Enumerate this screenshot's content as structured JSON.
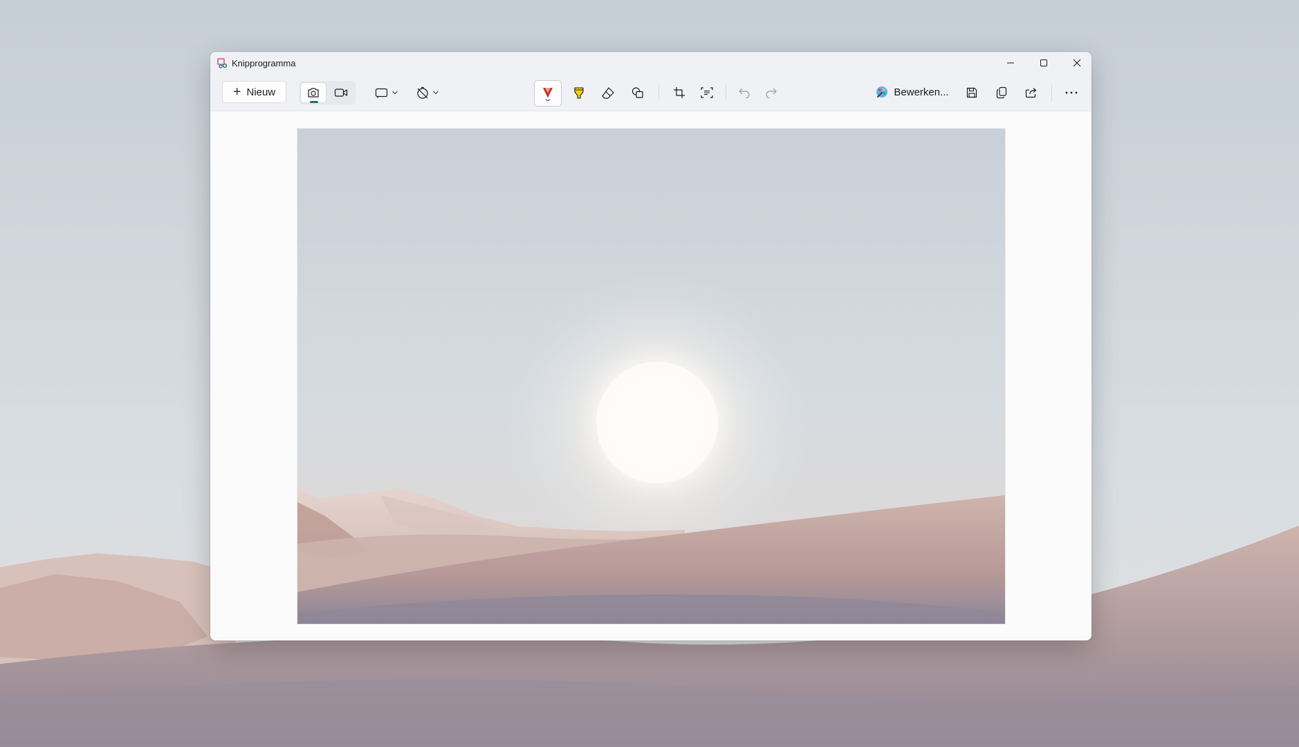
{
  "window": {
    "title": "Knipprogramma"
  },
  "toolbar": {
    "new_label": "Nieuw",
    "edit_label": "Bewerken..."
  },
  "colors": {
    "accent": "#1d6f6b",
    "pen_red": "#c42b1c",
    "highlighter_yellow": "#f2d21b",
    "sky": "#cdd4db",
    "dune": "#b99c98"
  },
  "icons": {
    "mode_photo": "camera-icon",
    "mode_video": "video-camera-icon",
    "shape": "rectangle-snip-icon",
    "timer": "no-delay-timer-icon",
    "pen": "ballpoint-pen-icon",
    "highlighter": "highlighter-icon",
    "eraser": "eraser-icon",
    "shapes": "shapes-icon",
    "crop": "crop-icon",
    "text_actions": "text-actions-icon",
    "undo": "undo-icon",
    "redo": "redo-icon",
    "paint": "paint-app-icon",
    "save": "save-icon",
    "copy": "copy-icon",
    "share": "share-icon",
    "more": "more-icon"
  }
}
